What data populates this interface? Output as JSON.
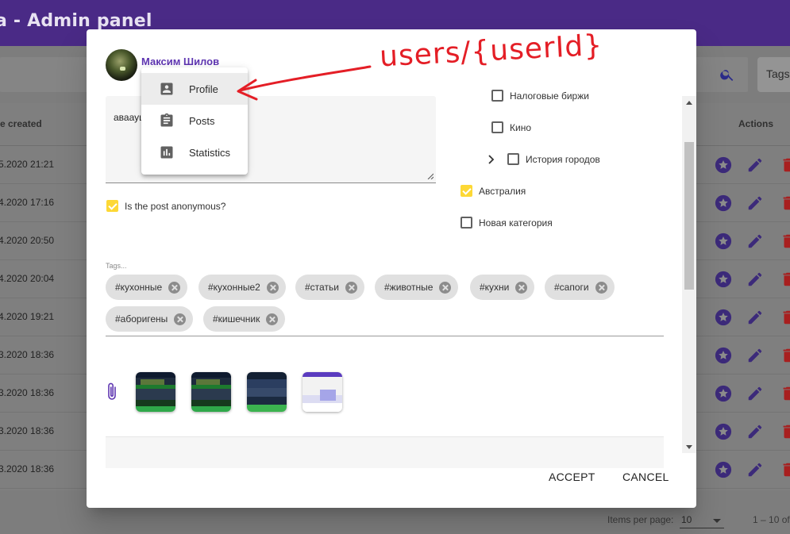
{
  "app": {
    "title": "a - Admin panel"
  },
  "background": {
    "tags_button_label": "Tags",
    "table": {
      "headers": {
        "date": "te created",
        "actions": "Actions"
      },
      "rows": [
        "5.2020 21:21",
        "4.2020 17:16",
        "4.2020 20:50",
        "4.2020 20:04",
        "4.2020 19:21",
        "3.2020 18:36",
        "3.2020 18:36",
        "3.2020 18:36",
        "3.2020 18:36"
      ]
    },
    "footer": {
      "items_per_page_label": "Items per page:",
      "items_per_page_value": "10",
      "range": "1 – 10 of"
    }
  },
  "dialog": {
    "author_name": "Максим Шилов",
    "text_value": "аваауш",
    "anonymous_label": "Is the post anonymous?",
    "anonymous_checked": true,
    "categories": [
      {
        "label": "Налоговые биржи",
        "checked": false
      },
      {
        "label": "Кино",
        "checked": false
      },
      {
        "label": "История городов",
        "checked": false,
        "expandable": true
      },
      {
        "label": "Австралия",
        "checked": true
      },
      {
        "label": "Новая категория",
        "checked": false
      }
    ],
    "tags_hint": "Tags...",
    "tags": [
      "#кухонные",
      "#кухонные2",
      "#статьи",
      "#животные",
      "#кухни",
      "#сапоги",
      "#аборигены",
      "#кишечник"
    ],
    "attachments_count": 4,
    "accept_label": "ACCEPT",
    "cancel_label": "CANCEL"
  },
  "user_menu": {
    "items": [
      {
        "label": "Profile",
        "icon": "account-box-icon",
        "active": true
      },
      {
        "label": "Posts",
        "icon": "assignment-icon",
        "active": false
      },
      {
        "label": "Statistics",
        "icon": "bar-chart-icon",
        "active": false
      }
    ]
  },
  "annotation": {
    "text": "users/{userId}"
  },
  "colors": {
    "header": "#4a2a86",
    "accent": "#5e35b1",
    "checkbox": "#fdd835",
    "delete": "#c62828",
    "annotation": "#e41e26"
  }
}
